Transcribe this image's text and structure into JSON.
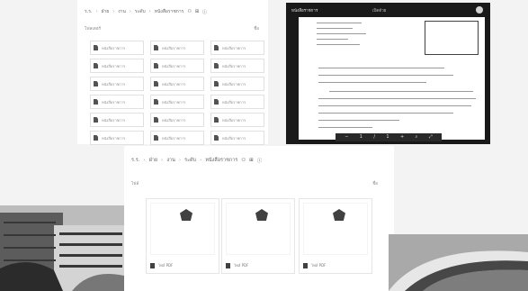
{
  "drive_list": {
    "breadcrumbs": [
      "ร.ร.",
      "ฝ่าย",
      "งาน",
      "ระดับ",
      "หนังสือราชการ"
    ],
    "sub_left": "โฟลเดอร์",
    "sub_right": "ชื่อ",
    "tiles": [
      "หนังสือราชการ",
      "หนังสือราชการ",
      "หนังสือราชการ",
      "หนังสือราชการ",
      "หนังสือราชการ",
      "หนังสือราชการ",
      "หนังสือราชการ",
      "หนังสือราชการ",
      "หนังสือราชการ",
      "หนังสือราชการ",
      "หนังสือราชการ",
      "หนังสือราชการ",
      "หนังสือราชการ",
      "หนังสือราชการ",
      "หนังสือราชการ",
      "หนังสือราชการ",
      "หนังสือราชการ",
      "หนังสือราชการ"
    ]
  },
  "viewer": {
    "title": "หนังสือราชการ",
    "mid": "เปิดด้วย",
    "toolbar": [
      "−",
      "1",
      "/",
      "1",
      "+",
      "⌕",
      "⤢"
    ]
  },
  "drive_grid": {
    "breadcrumbs": [
      "ร.ร.",
      "ฝ่าย",
      "งาน",
      "ระดับ",
      "หนังสือราชการ"
    ],
    "sub_left": "ไฟล์",
    "sub_right": "ชื่อ",
    "cards": [
      "ไฟล์ PDF",
      "ไฟล์ PDF",
      "ไฟล์ PDF"
    ]
  }
}
